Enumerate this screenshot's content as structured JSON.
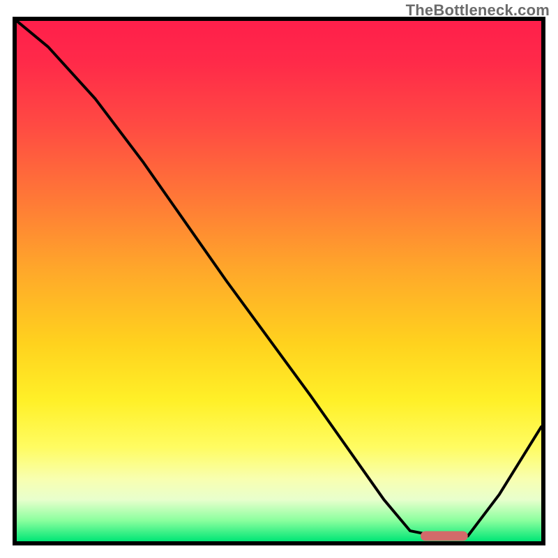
{
  "watermark": "TheBottleneck.com",
  "chart_data": {
    "type": "line",
    "title": "",
    "xlabel": "",
    "ylabel": "",
    "xlim": [
      0,
      100
    ],
    "ylim": [
      0,
      100
    ],
    "grid": false,
    "legend": false,
    "background_gradient": {
      "stops": [
        {
          "pos": 0,
          "color": "#ff1f4b"
        },
        {
          "pos": 35,
          "color": "#ff7b36"
        },
        {
          "pos": 62,
          "color": "#ffd21e"
        },
        {
          "pos": 82,
          "color": "#fffc62"
        },
        {
          "pos": 96,
          "color": "#8bff9e"
        },
        {
          "pos": 100,
          "color": "#00e676"
        }
      ]
    },
    "series": [
      {
        "name": "bottleneck-curve",
        "color": "#000000",
        "x": [
          0,
          6,
          15,
          24,
          40,
          56,
          70,
          75,
          80,
          86,
          92,
          100
        ],
        "values": [
          100,
          95,
          85,
          73,
          50,
          28,
          8,
          2,
          1,
          1,
          9,
          22
        ]
      }
    ],
    "marker": {
      "name": "optimal-range",
      "shape": "rounded-bar",
      "x_start": 77,
      "x_end": 86,
      "y": 1,
      "color": "#d26a6a"
    }
  }
}
